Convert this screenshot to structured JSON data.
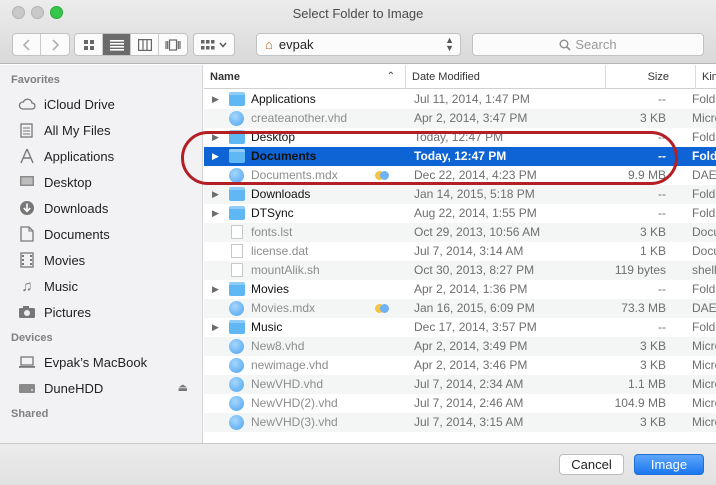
{
  "window": {
    "title": "Select Folder to Image"
  },
  "toolbar": {
    "path": "evpak",
    "search_placeholder": "Search"
  },
  "sidebar": {
    "favorites_heading": "Favorites",
    "favorites": [
      {
        "label": "iCloud Drive",
        "icon": "cloud-icon"
      },
      {
        "label": "All My Files",
        "icon": "all-files-icon"
      },
      {
        "label": "Applications",
        "icon": "applications-icon"
      },
      {
        "label": "Desktop",
        "icon": "desktop-icon"
      },
      {
        "label": "Downloads",
        "icon": "downloads-icon"
      },
      {
        "label": "Documents",
        "icon": "documents-icon"
      },
      {
        "label": "Movies",
        "icon": "movies-icon"
      },
      {
        "label": "Music",
        "icon": "music-icon"
      },
      {
        "label": "Pictures",
        "icon": "pictures-icon"
      }
    ],
    "devices_heading": "Devices",
    "devices": [
      {
        "label": "Evpak’s MacBook",
        "icon": "laptop-icon"
      },
      {
        "label": "DuneHDD",
        "icon": "drive-icon"
      }
    ],
    "shared_heading": "Shared"
  },
  "columns": {
    "name": "Name",
    "date": "Date Modified",
    "size": "Size",
    "kind": "Kind"
  },
  "files": [
    {
      "name": "Applications",
      "date": "Jul 11, 2014, 1:47 PM",
      "size": "--",
      "kind": "Folder",
      "type": "folder",
      "expand": true
    },
    {
      "name": "createanother.vhd",
      "date": "Apr 2, 2014, 3:47 PM",
      "size": "3 KB",
      "kind": "Microsoft",
      "type": "vhd"
    },
    {
      "name": "Desktop",
      "date": "Today, 12:47 PM",
      "size": "--",
      "kind": "Folder",
      "type": "folder",
      "expand": true
    },
    {
      "name": "Documents",
      "date": "Today, 12:47 PM",
      "size": "--",
      "kind": "Folder",
      "type": "folder",
      "expand": true,
      "selected": true
    },
    {
      "name": "Documents.mdx",
      "date": "Dec 22, 2014, 4:23 PM",
      "size": "9.9 MB",
      "kind": "DAEMON",
      "type": "vhd",
      "tag": true
    },
    {
      "name": "Downloads",
      "date": "Jan 14, 2015, 5:18 PM",
      "size": "--",
      "kind": "Folder",
      "type": "folder",
      "expand": true
    },
    {
      "name": "DTSync",
      "date": "Aug 22, 2014, 1:55 PM",
      "size": "--",
      "kind": "Folder",
      "type": "folder",
      "expand": true
    },
    {
      "name": "fonts.lst",
      "date": "Oct 29, 2013, 10:56 AM",
      "size": "3 KB",
      "kind": "Document",
      "type": "doc"
    },
    {
      "name": "license.dat",
      "date": "Jul 7, 2014, 3:14 AM",
      "size": "1 KB",
      "kind": "Document",
      "type": "doc"
    },
    {
      "name": "mountAlik.sh",
      "date": "Oct 30, 2013, 8:27 PM",
      "size": "119 bytes",
      "kind": "shell script",
      "type": "doc"
    },
    {
      "name": "Movies",
      "date": "Apr 2, 2014, 1:36 PM",
      "size": "--",
      "kind": "Folder",
      "type": "folder",
      "expand": true
    },
    {
      "name": "Movies.mdx",
      "date": "Jan 16, 2015, 6:09 PM",
      "size": "73.3 MB",
      "kind": "DAEMON",
      "type": "vhd",
      "tag": true
    },
    {
      "name": "Music",
      "date": "Dec 17, 2014, 3:57 PM",
      "size": "--",
      "kind": "Folder",
      "type": "folder",
      "expand": true
    },
    {
      "name": "New8.vhd",
      "date": "Apr 2, 2014, 3:49 PM",
      "size": "3 KB",
      "kind": "Microsoft",
      "type": "vhd"
    },
    {
      "name": "newimage.vhd",
      "date": "Apr 2, 2014, 3:46 PM",
      "size": "3 KB",
      "kind": "Microsoft",
      "type": "vhd"
    },
    {
      "name": "NewVHD.vhd",
      "date": "Jul 7, 2014, 2:34 AM",
      "size": "1.1 MB",
      "kind": "Microsoft",
      "type": "vhd"
    },
    {
      "name": "NewVHD(2).vhd",
      "date": "Jul 7, 2014, 2:46 AM",
      "size": "104.9 MB",
      "kind": "Microsoft",
      "type": "vhd"
    },
    {
      "name": "NewVHD(3).vhd",
      "date": "Jul 7, 2014, 3:15 AM",
      "size": "3 KB",
      "kind": "Microsoft",
      "type": "vhd"
    }
  ],
  "buttons": {
    "cancel": "Cancel",
    "image": "Image"
  },
  "colors": {
    "selection": "#0e63d5",
    "highlight_ring": "#b31f24",
    "folder": "#5fb7f3",
    "primary_button": "#1a76ee"
  }
}
